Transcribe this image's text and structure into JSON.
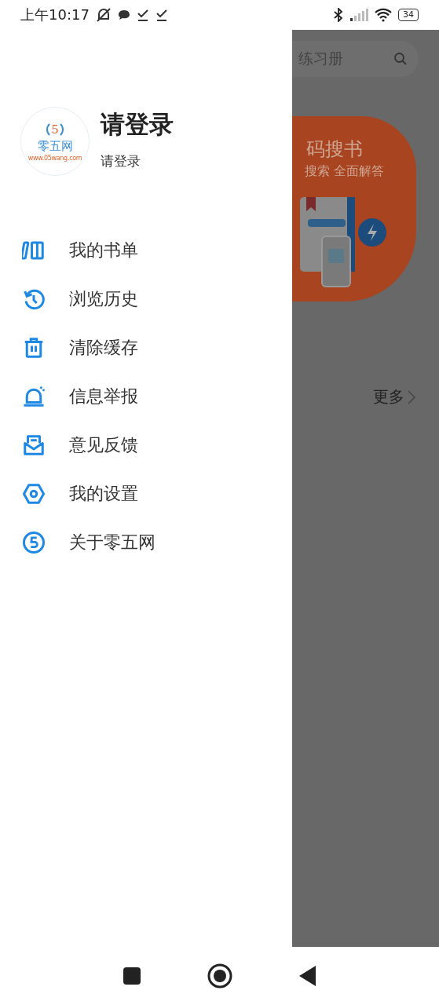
{
  "status_bar": {
    "time": "上午10:17",
    "battery": "34"
  },
  "drawer": {
    "logo": {
      "digit": "5",
      "name": "零五网",
      "url": "www.05wang.com"
    },
    "title": "请登录",
    "subtitle": "请登录",
    "items": [
      {
        "label": "我的书单"
      },
      {
        "label": "浏览历史"
      },
      {
        "label": "清除缓存"
      },
      {
        "label": "信息举报"
      },
      {
        "label": "意见反馈"
      },
      {
        "label": "我的设置"
      },
      {
        "label": "关于零五网"
      }
    ]
  },
  "background": {
    "search": {
      "placeholder": "练习册"
    },
    "banner": {
      "title": "码搜书",
      "subtitle": "搜索 全面解答"
    },
    "more": "更多"
  }
}
